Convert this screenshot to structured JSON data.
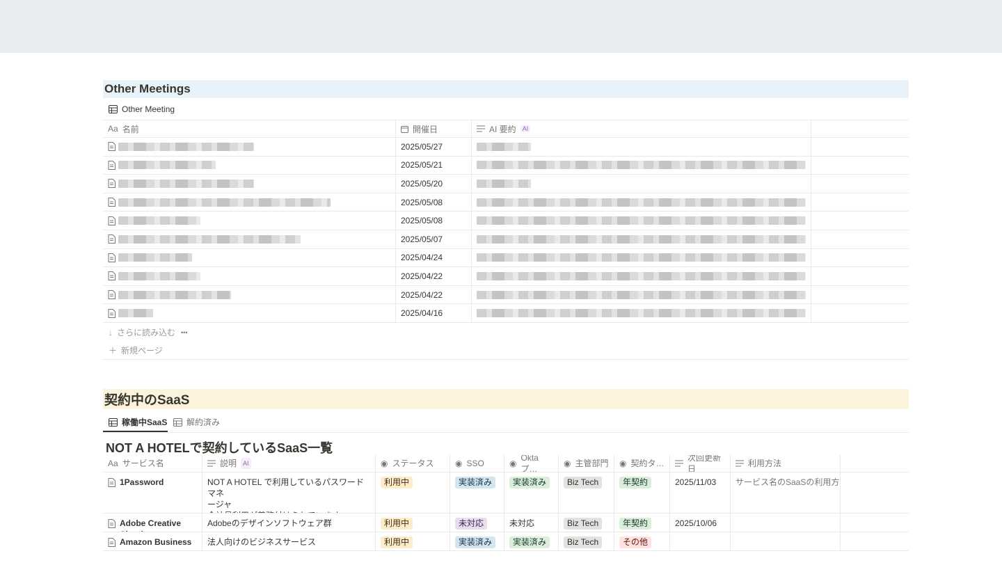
{
  "meetings": {
    "heading": "Other Meetings",
    "view_label": "Other Meeting",
    "columns": {
      "name_prefix": "Aa",
      "name": "名前",
      "date": "開催日",
      "summary": "AI 要約",
      "ai_badge": "AI"
    },
    "rows": [
      {
        "date": "2025/05/27"
      },
      {
        "date": "2025/05/21"
      },
      {
        "date": "2025/05/20"
      },
      {
        "date": "2025/05/08"
      },
      {
        "date": "2025/05/08"
      },
      {
        "date": "2025/05/07"
      },
      {
        "date": "2025/04/24"
      },
      {
        "date": "2025/04/22"
      },
      {
        "date": "2025/04/22"
      },
      {
        "date": "2025/04/16"
      }
    ],
    "load_more": "さらに読み込む",
    "more_dots": "•••",
    "new_page": "新規ページ"
  },
  "saas": {
    "heading": "契約中のSaaS",
    "tabs": [
      "稼働中SaaS",
      "解約済み"
    ],
    "title": "NOT A HOTELで契約しているSaaS一覧",
    "columns": {
      "name_prefix": "Aa",
      "name": "サービス名",
      "description": "説明",
      "ai_badge": "AI",
      "status": "ステータス",
      "sso": "SSO",
      "okta": "Oktaプ…",
      "dept": "主管部門",
      "contract": "契約タ…",
      "renewal": "次回更新日",
      "usage": "利用方法"
    },
    "rows": [
      {
        "name": "1Password",
        "desc1": "NOT A HOTEL で利用しているパスワードマネ",
        "desc2": "ージャ",
        "desc3": "全社員利用が義務付けられています。",
        "status": "利用中",
        "sso": "実装済み",
        "okta": "実装済み",
        "dept": "Biz Tech",
        "contract": "年契約",
        "renewal": "2025/11/03",
        "usage": "サービス名のSaaSの利用方法が"
      },
      {
        "name": "Adobe Creative Cloud",
        "desc1": "Adobeのデザインソフトウェア群",
        "desc2": "",
        "desc3": "",
        "status": "利用中",
        "sso": "未対応",
        "okta": "未対応",
        "dept": "Biz Tech",
        "contract": "年契約",
        "renewal": "2025/10/06",
        "usage": ""
      },
      {
        "name": "Amazon Business",
        "desc1": "法人向けのビジネスサービス",
        "desc2": "",
        "desc3": "",
        "status": "利用中",
        "sso": "実装済み",
        "okta": "実装済み",
        "dept": "Biz Tech",
        "contract": "その他",
        "renewal": "",
        "usage": ""
      }
    ]
  }
}
